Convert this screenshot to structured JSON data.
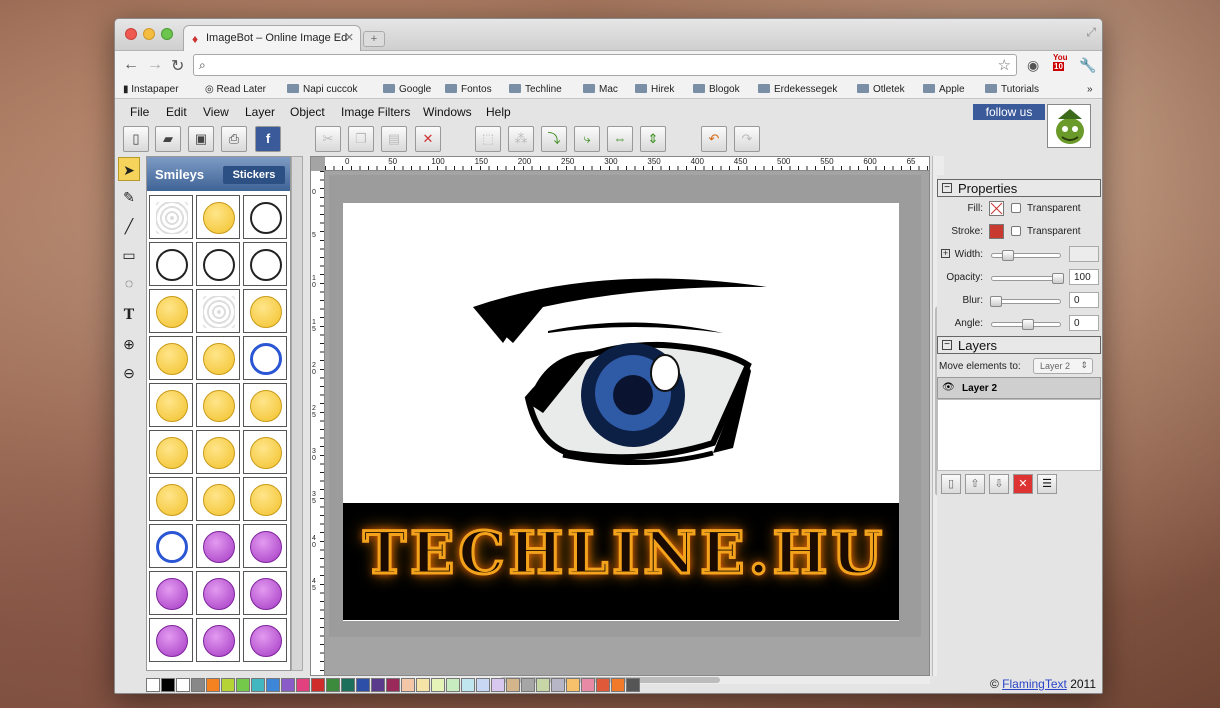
{
  "browser": {
    "tab_title": "ImageBot – Online Image Ed",
    "tab_favicon": "carrot-icon",
    "bookmarks": [
      {
        "label": "Instapaper",
        "icon": "instapaper-icon"
      },
      {
        "label": "Read Later",
        "icon": "globe-icon"
      },
      {
        "label": "Napi cuccok",
        "icon": "folder-icon"
      },
      {
        "label": "Google",
        "icon": "folder-icon"
      },
      {
        "label": "Fontos",
        "icon": "folder-icon"
      },
      {
        "label": "Techline",
        "icon": "folder-icon"
      },
      {
        "label": "Mac",
        "icon": "folder-icon"
      },
      {
        "label": "Hirek",
        "icon": "folder-icon"
      },
      {
        "label": "Blogok",
        "icon": "folder-icon"
      },
      {
        "label": "Erdekessegek",
        "icon": "folder-icon"
      },
      {
        "label": "Otletek",
        "icon": "folder-icon"
      },
      {
        "label": "Apple",
        "icon": "folder-icon"
      },
      {
        "label": "Tutorials",
        "icon": "folder-icon"
      }
    ],
    "more_bookmarks": "»",
    "youtube_badge": "10"
  },
  "app": {
    "menu": [
      "File",
      "Edit",
      "View",
      "Layer",
      "Object",
      "Image Filters",
      "Windows",
      "Help"
    ],
    "follow_label": "follow us",
    "palette": {
      "title": "Smileys",
      "tab": "Stickers"
    },
    "banner_text": "TECHLINE.HU",
    "ruler_h": [
      "0",
      "50",
      "100",
      "150",
      "200",
      "250",
      "300",
      "350",
      "400",
      "450",
      "500",
      "550",
      "600",
      "65"
    ],
    "ruler_v": [
      "0",
      "5",
      "1 0",
      "1 5",
      "2 0",
      "2 5",
      "3 0",
      "3 5",
      "4 0",
      "4 5"
    ],
    "colors": [
      "#ffffff",
      "#000000",
      "#ffffff",
      "#888888",
      "#f58220",
      "#b5d334",
      "#74c94a",
      "#43b7c0",
      "#3e86d8",
      "#8a5cc8",
      "#e2417f",
      "#cf2c2c",
      "#3c8b3c",
      "#1c6f5a",
      "#2d4fa8",
      "#5a3a8a",
      "#9a2a5a",
      "#f3c6a8",
      "#f6e3a8",
      "#e5f2b8",
      "#c6ecc0",
      "#c0e6ef",
      "#c8d8f4",
      "#d8c8f0",
      "#d4b48a",
      "#a6a6a6",
      "#c6d6a6",
      "#b6b6c6",
      "#f7c06a",
      "#e68aa6",
      "#e05a3a",
      "#f07a2a",
      "#555555"
    ]
  },
  "properties": {
    "title": "Properties",
    "fill_label": "Fill:",
    "stroke_label": "Stroke:",
    "transparent_label": "Transparent",
    "width_label": "Width:",
    "opacity_label": "Opacity:",
    "opacity_value": "100",
    "blur_label": "Blur:",
    "blur_value": "0",
    "angle_label": "Angle:",
    "angle_value": "0",
    "stroke_color": "#c8392f"
  },
  "layers": {
    "title": "Layers",
    "move_label": "Move elements to:",
    "move_select": "Layer 2",
    "items": [
      "Layer 2"
    ]
  },
  "footer": {
    "copyright": "©",
    "link": "FlamingText",
    "year": "2011"
  }
}
